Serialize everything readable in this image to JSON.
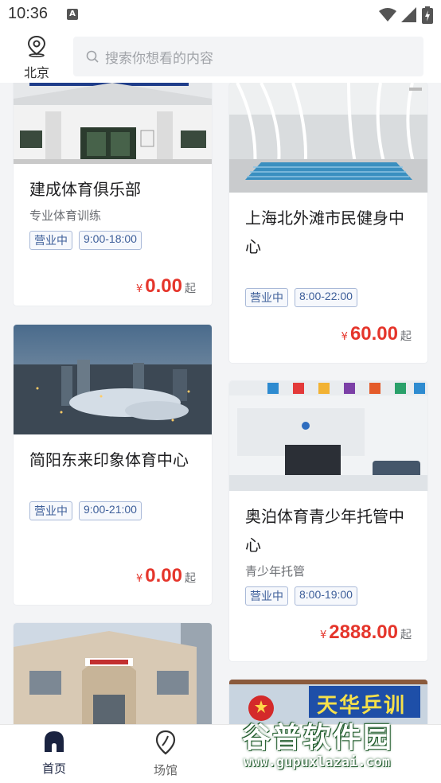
{
  "status_bar": {
    "time": "10:36",
    "notif_icon": "A"
  },
  "header": {
    "city": "北京",
    "search_placeholder": "搜索你想看的内容"
  },
  "venues": [
    {
      "title": "建成体育俱乐部",
      "subtitle": "专业体育训练",
      "status": "营业中",
      "hours": "9:00-18:00",
      "currency": "¥",
      "price": "0.00",
      "price_suffix": "起"
    },
    {
      "title": "上海北外滩市民健身中心",
      "subtitle": "",
      "status": "营业中",
      "hours": "8:00-22:00",
      "currency": "¥",
      "price": "60.00",
      "price_suffix": "起"
    },
    {
      "title": "简阳东来印象体育中心",
      "subtitle": "",
      "status": "营业中",
      "hours": "9:00-21:00",
      "currency": "¥",
      "price": "0.00",
      "price_suffix": "起"
    },
    {
      "title": "奥泊体育青少年托管中心",
      "subtitle": "青少年托管",
      "status": "营业中",
      "hours": "8:00-19:00",
      "currency": "¥",
      "price": "2888.00",
      "price_suffix": "起"
    }
  ],
  "image_text": {
    "banner": "天华乒训"
  },
  "tabs": [
    {
      "label": "首页",
      "active": true
    },
    {
      "label": "场馆",
      "active": false
    }
  ],
  "watermark": {
    "main": "谷普软件园",
    "url": "www.gupuxlazai.com"
  },
  "colors": {
    "price": "#e5352b",
    "tag": "#3e5f9a",
    "active_tab": "#1a2340"
  }
}
